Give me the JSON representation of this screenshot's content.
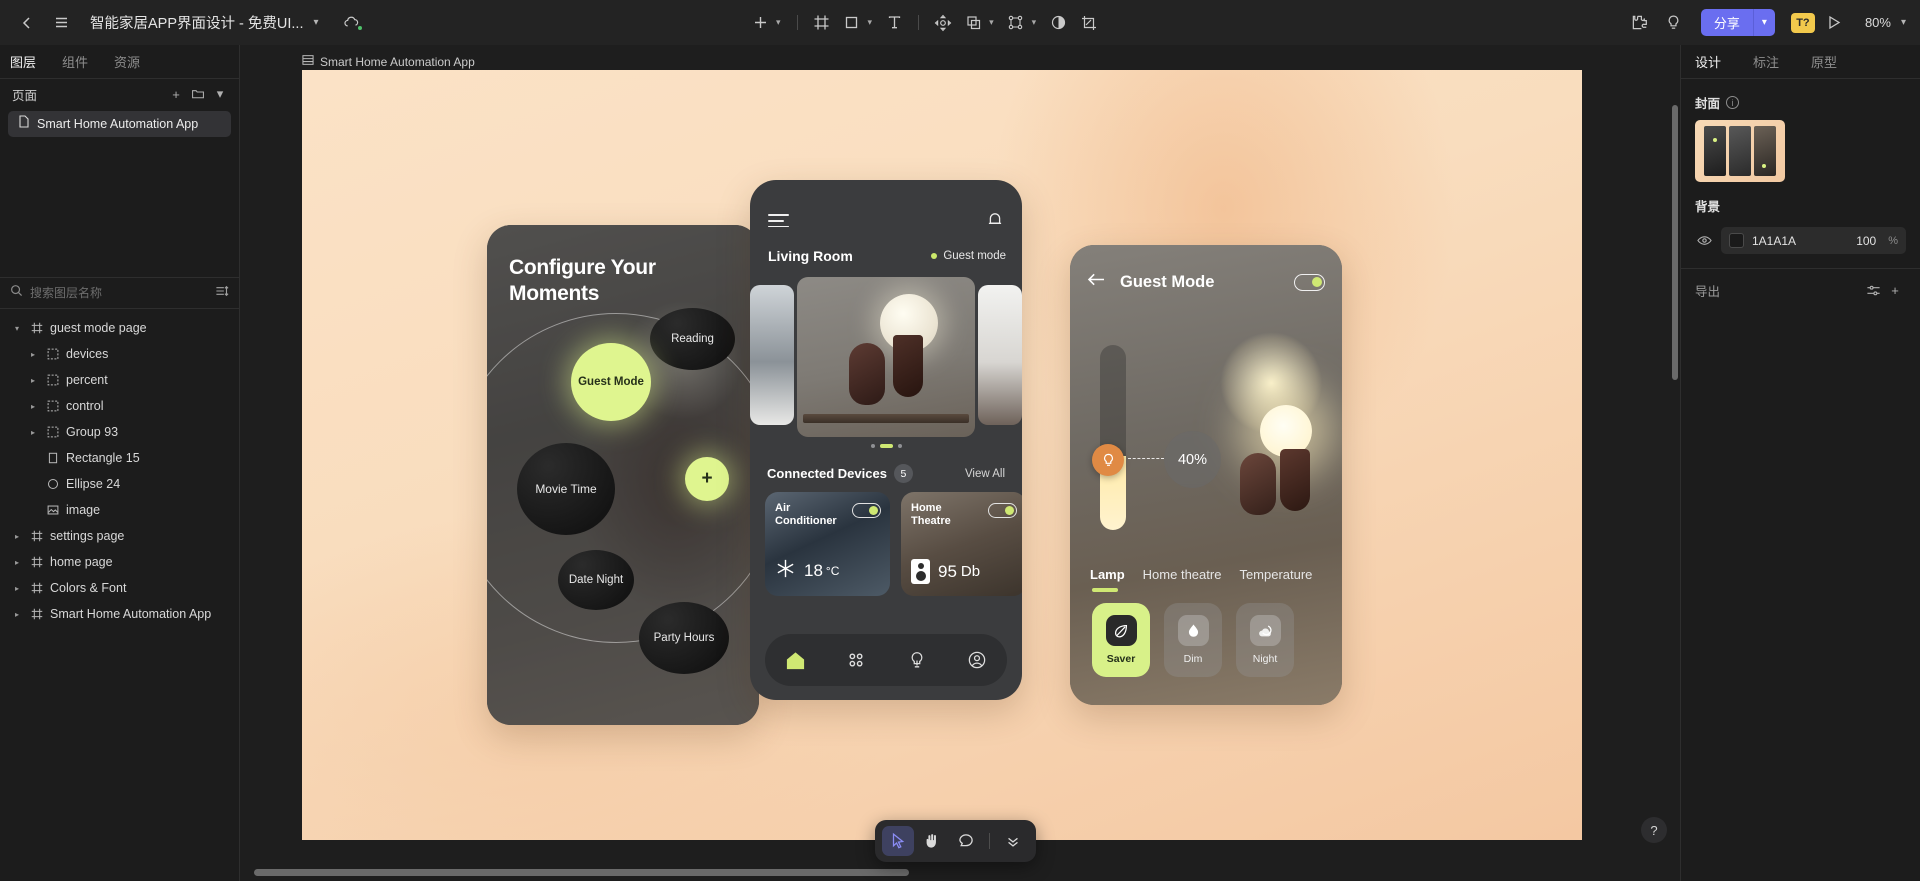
{
  "topbar": {
    "back_icon": "back-chevron-icon",
    "menu_icon": "hamburger-menu-icon",
    "doc_title": "智能家居APP界面设计 - 免费UI...",
    "title_chevron": "▾",
    "cloud_icon": "cloud-sync-icon",
    "tools": [
      {
        "name": "add-tool",
        "glyph": "+",
        "has_chevron": true
      },
      {
        "name": "frame-tool",
        "glyph": "frame",
        "has_chevron": false
      },
      {
        "name": "shape-tool",
        "glyph": "square",
        "has_chevron": true
      },
      {
        "name": "text-tool",
        "glyph": "T",
        "has_chevron": false
      },
      {
        "name": "move-tool",
        "glyph": "move",
        "has_chevron": false
      },
      {
        "name": "boolean-tool",
        "glyph": "boolean",
        "has_chevron": true
      },
      {
        "name": "component-tool",
        "glyph": "component",
        "has_chevron": true
      },
      {
        "name": "mask-tool",
        "glyph": "contrast",
        "has_chevron": false
      },
      {
        "name": "slice-tool",
        "glyph": "slice",
        "has_chevron": false
      }
    ],
    "plugin_icon": "plugin-puzzle-icon",
    "idea_icon": "lightbulb-icon",
    "share_label": "分享",
    "share_chevron": "▾",
    "ai_badge": "T?",
    "present_icon": "play-present-icon",
    "zoom_level": "80%",
    "zoom_chevron": "▾"
  },
  "left_panel": {
    "tabs": [
      {
        "label": "图层",
        "active": true
      },
      {
        "label": "组件",
        "active": false
      },
      {
        "label": "资源",
        "active": false
      }
    ],
    "pages_label": "页面",
    "pages_add_icon": "+",
    "pages_folder_icon": "folder-icon",
    "pages_collapse_icon": "▾",
    "page_items": [
      {
        "label": "Smart Home Automation App",
        "icon": "page-file-icon",
        "selected": true
      }
    ],
    "search_placeholder": "搜索图层名称",
    "search_icon": "search-icon",
    "sort_icon": "sort-filter-icon",
    "layers": [
      {
        "label": "guest mode page",
        "icon": "frame-icon",
        "indent": 0,
        "twisty": "▾"
      },
      {
        "label": "devices",
        "icon": "group-icon",
        "indent": 1,
        "twisty": "▸"
      },
      {
        "label": "percent",
        "icon": "group-icon",
        "indent": 1,
        "twisty": "▸"
      },
      {
        "label": "control",
        "icon": "group-icon",
        "indent": 1,
        "twisty": "▸"
      },
      {
        "label": "Group 93",
        "icon": "group-icon",
        "indent": 1,
        "twisty": "▸"
      },
      {
        "label": "Rectangle 15",
        "icon": "rect-icon",
        "indent": 1,
        "twisty": ""
      },
      {
        "label": "Ellipse 24",
        "icon": "ellipse-icon",
        "indent": 1,
        "twisty": ""
      },
      {
        "label": "image",
        "icon": "image-icon",
        "indent": 1,
        "twisty": ""
      },
      {
        "label": "settings page",
        "icon": "frame-icon",
        "indent": 0,
        "twisty": "▸"
      },
      {
        "label": "home page",
        "icon": "frame-icon",
        "indent": 0,
        "twisty": "▸"
      },
      {
        "label": "Colors & Font",
        "icon": "frame-icon",
        "indent": 0,
        "twisty": "▸"
      },
      {
        "label": "Smart Home Automation App",
        "icon": "frame-icon",
        "indent": 0,
        "twisty": "▸"
      }
    ]
  },
  "right_panel": {
    "tabs": [
      {
        "label": "设计",
        "active": true
      },
      {
        "label": "标注",
        "active": false
      },
      {
        "label": "原型",
        "active": false
      }
    ],
    "cover_label": "封面",
    "cover_info_icon": "info-icon",
    "background_label": "背景",
    "bg_visibility_icon": "eye-icon",
    "bg_color_hex": "1A1A1A",
    "bg_opacity": "100",
    "bg_opacity_unit": "%",
    "export_label": "导出",
    "export_settings_icon": "sliders-icon",
    "export_add_icon": "+"
  },
  "canvas": {
    "frame_label": "Smart Home Automation App",
    "frame_icon": "frame-thumb-icon",
    "artboard_bg": "#f7dcc0"
  },
  "phone1": {
    "title": "Configure Your Moments",
    "bubbles": [
      {
        "label": "Reading",
        "style": "dark"
      },
      {
        "label": "Guest Mode",
        "style": "lime"
      },
      {
        "label": "Movie Time",
        "style": "dark"
      },
      {
        "label": "Date Night",
        "style": "dark"
      },
      {
        "label": "Party Hours",
        "style": "dark"
      }
    ],
    "add_button": "+"
  },
  "phone2": {
    "menu_icon": "hamburger-menu-icon",
    "bell_icon": "notification-bell-icon",
    "room": "Living Room",
    "mode_label": "Guest mode",
    "carousel_dots": 3,
    "carousel_active_index": 1,
    "connected_label": "Connected Devices",
    "connected_count": "5",
    "view_all": "View All",
    "devices": [
      {
        "name": "Air Conditioner",
        "value": "18",
        "unit": "°C",
        "icon": "snowflake-icon",
        "on": true
      },
      {
        "name": "Home Theatre",
        "value": "95",
        "unit": "Db",
        "icon": "speaker-icon",
        "on": true
      }
    ],
    "nav": [
      {
        "name": "home-icon",
        "active": true
      },
      {
        "name": "grid-icon",
        "active": false
      },
      {
        "name": "bulb-icon",
        "active": false
      },
      {
        "name": "profile-icon",
        "active": false
      }
    ]
  },
  "phone3": {
    "back_icon": "arrow-left-icon",
    "title": "Guest Mode",
    "toggle_on": true,
    "slider_value": "40%",
    "slider_fill_percent": 40,
    "slider_knob_icon": "bulb-icon",
    "tabs": [
      {
        "label": "Lamp",
        "active": true
      },
      {
        "label": "Home theatre",
        "active": false
      },
      {
        "label": "Temperature",
        "active": false
      }
    ],
    "scenes": [
      {
        "label": "Saver",
        "icon": "leaf-icon",
        "active": true
      },
      {
        "label": "Dim",
        "icon": "droplet-icon",
        "active": false
      },
      {
        "label": "Night",
        "icon": "moon-cloud-icon",
        "active": false
      }
    ]
  },
  "floating_toolbar": {
    "tools": [
      {
        "name": "cursor-select-tool",
        "glyph": "cursor",
        "selected": true
      },
      {
        "name": "hand-pan-tool",
        "glyph": "hand",
        "selected": false
      },
      {
        "name": "comment-tool",
        "glyph": "comment",
        "selected": false
      },
      {
        "name": "more-tools",
        "glyph": "chevron-double-down",
        "selected": false
      }
    ]
  },
  "help_button": {
    "label": "?"
  }
}
